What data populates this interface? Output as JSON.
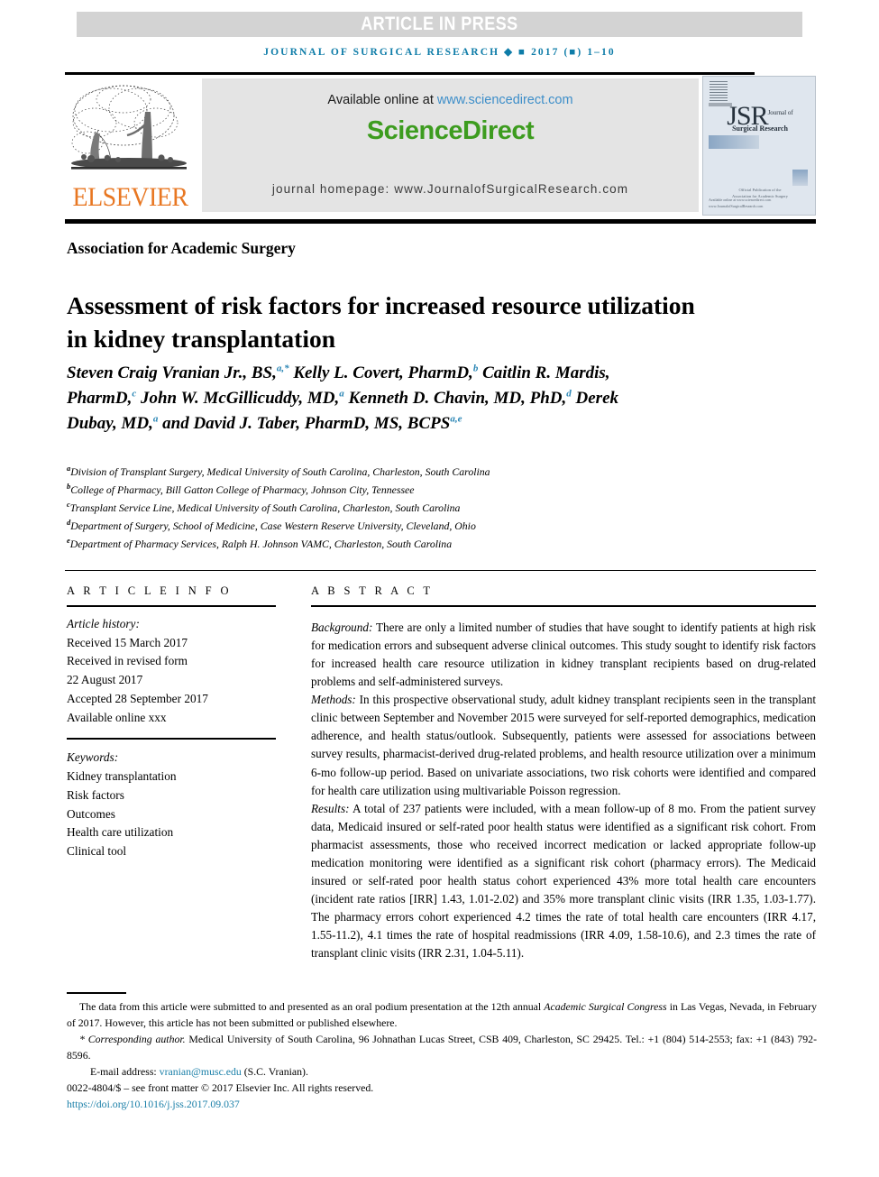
{
  "banner": {
    "press_label": "ARTICLE IN PRESS",
    "running_head": "JOURNAL OF SURGICAL RESEARCH ◆ ■ 2017 (■) 1–10"
  },
  "masthead": {
    "publisher_name": "ELSEVIER",
    "available_prefix": "Available online at ",
    "available_url": "www.sciencedirect.com",
    "wordmark": "ScienceDirect",
    "homepage": "journal homepage: www.JournalofSurgicalResearch.com",
    "cover": {
      "title": "JSR",
      "title_sup": "Journal of",
      "subtitle": "Surgical Research",
      "note": "Official Publication of the\nAssociation for Academic Surgery",
      "footer": "Available online at www.sciencedirect.com\nwww.JournalofSurgicalResearch.com"
    }
  },
  "article": {
    "society": "Association for Academic Surgery",
    "title": "Assessment of risk factors for increased resource utilization in kidney transplantation",
    "authors_html": "Steven Craig Vranian Jr., BS,<sup>a,*</sup> Kelly L. Covert, PharmD,<sup>b</sup> Caitlin R. Mardis, PharmD,<sup>c</sup> John W. McGillicuddy, MD,<sup>a</sup> Kenneth D. Chavin, MD, PhD,<sup>d</sup> Derek Dubay, MD,<sup>a</sup> and David J. Taber, PharmD, MS, BCPS<sup>a,e</sup>",
    "affiliations": [
      {
        "mark": "a",
        "text": "Division of Transplant Surgery, Medical University of South Carolina, Charleston, South Carolina"
      },
      {
        "mark": "b",
        "text": "College of Pharmacy, Bill Gatton College of Pharmacy, Johnson City, Tennessee"
      },
      {
        "mark": "c",
        "text": "Transplant Service Line, Medical University of South Carolina, Charleston, South Carolina"
      },
      {
        "mark": "d",
        "text": "Department of Surgery, School of Medicine, Case Western Reserve University, Cleveland, Ohio"
      },
      {
        "mark": "e",
        "text": "Department of Pharmacy Services, Ralph H. Johnson VAMC, Charleston, South Carolina"
      }
    ]
  },
  "article_info": {
    "heading": "A R T I C L E    I N F O",
    "history_label": "Article history:",
    "history": [
      "Received 15 March 2017",
      "Received in revised form",
      "22 August 2017",
      "Accepted 28 September 2017",
      "Available online xxx"
    ],
    "keywords_label": "Keywords:",
    "keywords": [
      "Kidney transplantation",
      "Risk factors",
      "Outcomes",
      "Health care utilization",
      "Clinical tool"
    ]
  },
  "abstract": {
    "heading": "A B S T R A C T",
    "sections": [
      {
        "label": "Background:",
        "text": " There are only a limited number of studies that have sought to identify patients at high risk for medication errors and subsequent adverse clinical outcomes. This study sought to identify risk factors for increased health care resource utilization in kidney transplant recipients based on drug-related problems and self-administered surveys."
      },
      {
        "label": "Methods:",
        "text": " In this prospective observational study, adult kidney transplant recipients seen in the transplant clinic between September and November 2015 were surveyed for self-reported demographics, medication adherence, and health status/outlook. Subsequently, patients were assessed for associations between survey results, pharmacist-derived drug-related problems, and health resource utilization over a minimum 6-mo follow-up period. Based on univariate associations, two risk cohorts were identified and compared for health care utilization using multivariable Poisson regression."
      },
      {
        "label": "Results:",
        "text": " A total of 237 patients were included, with a mean follow-up of 8 mo. From the patient survey data, Medicaid insured or self-rated poor health status were identified as a significant risk cohort. From pharmacist assessments, those who received incorrect medication or lacked appropriate follow-up medication monitoring were identified as a significant risk cohort (pharmacy errors). The Medicaid insured or self-rated poor health status cohort experienced 43% more total health care encounters (incident rate ratios [IRR] 1.43, 1.01-2.02) and 35% more transplant clinic visits (IRR 1.35, 1.03-1.77). The pharmacy errors cohort experienced 4.2 times the rate of total health care encounters (IRR 4.17, 1.55-11.2), 4.1 times the rate of hospital readmissions (IRR 4.09, 1.58-10.6), and 2.3 times the rate of transplant clinic visits (IRR 2.31, 1.04-5.11)."
      }
    ]
  },
  "footnotes": {
    "presentation_pre": "The data from this article were submitted to and presented as an oral podium presentation at the 12th annual ",
    "presentation_italic": "Academic Surgical Congress",
    "presentation_post": " in Las Vegas, Nevada, in February of 2017. However, this article has not been submitted or published elsewhere.",
    "corresponding_star": "*",
    "corresponding_label": "Corresponding author.",
    "corresponding_text": " Medical University of South Carolina, 96 Johnathan Lucas Street, CSB 409, Charleston, SC 29425. Tel.: +1 (804) 514-2553; fax: +1 (843) 792-8596.",
    "email_label": "E-mail address: ",
    "email": "vranian@musc.edu",
    "email_suffix": " (S.C. Vranian).",
    "copyright": "0022-4804/$ – see front matter © 2017 Elsevier Inc. All rights reserved.",
    "doi": "https://doi.org/10.1016/j.jss.2017.09.037"
  },
  "colors": {
    "journal_blue": "#0e7ca8",
    "link_blue": "#1a7fa8",
    "sciencedirect_green": "#3d9c1f",
    "elsevier_orange": "#e87722",
    "banner_gray": "#d3d3d3",
    "panel_gray": "#e4e4e4",
    "affiliation_mark": "#2b86b5"
  }
}
